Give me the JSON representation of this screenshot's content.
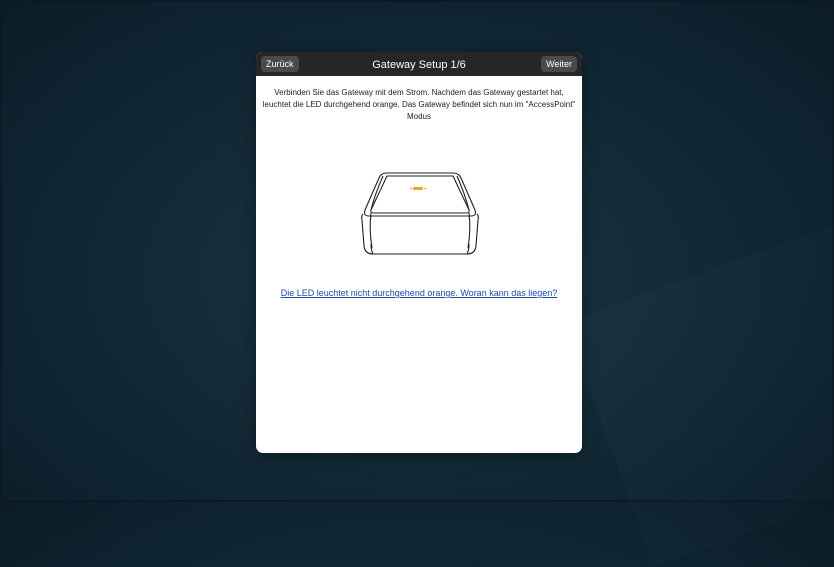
{
  "dialog": {
    "title": "Gateway Setup 1/6",
    "back_label": "Zurück",
    "next_label": "Weiter",
    "instructions": "Verbinden Sie das Gateway mit dem Strom. Nachdem das Gateway gestartet hat, leuchtet die LED durchgehend orange. Das Gateway befindet sich nun im \"AccessPoint\" Modus",
    "help_link": "Die LED leuchtet nicht durchgehend orange. Woran kann das liegen?"
  },
  "colors": {
    "header_bg": "#262626",
    "header_button_bg": "#4a4a4a",
    "link": "#1c4aa8",
    "led": "#f2a329"
  },
  "icons": {
    "device": "gateway-device-icon",
    "led": "led-indicator-icon"
  }
}
